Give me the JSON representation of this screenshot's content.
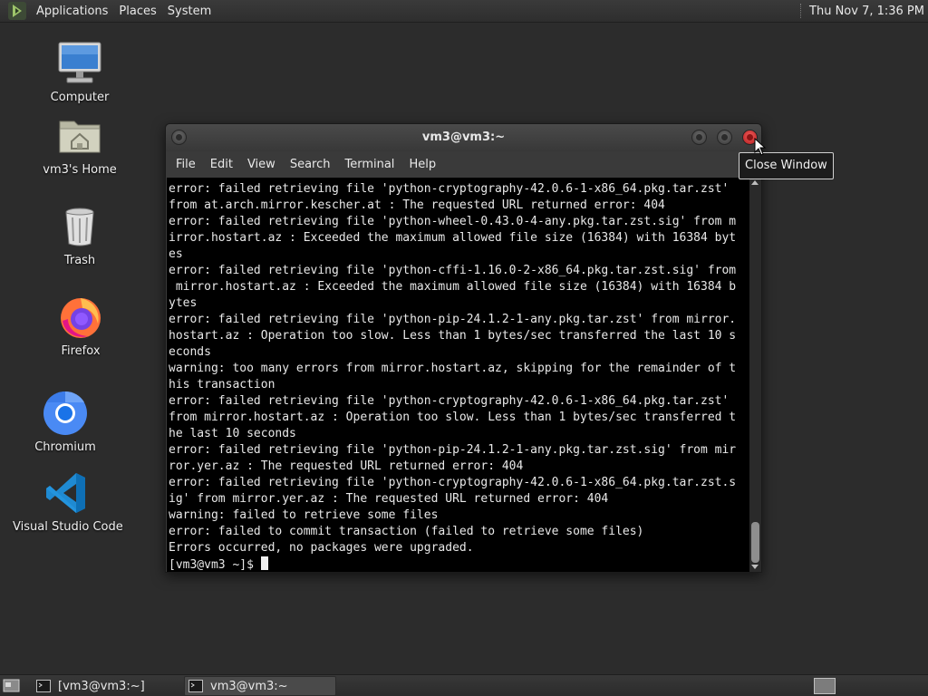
{
  "top_panel": {
    "menus": [
      "Applications",
      "Places",
      "System"
    ],
    "clock": "Thu Nov 7,  1:36 PM"
  },
  "desktop_icons": [
    {
      "label": "Computer",
      "icon": "computer-icon"
    },
    {
      "label": "vm3's Home",
      "icon": "home-folder-icon"
    },
    {
      "label": "Trash",
      "icon": "trash-icon"
    },
    {
      "label": "Firefox",
      "icon": "firefox-icon"
    },
    {
      "label": "Chromium",
      "icon": "chromium-icon"
    },
    {
      "label": "Visual Studio Code",
      "icon": "vscode-icon"
    }
  ],
  "terminal": {
    "title": "vm3@vm3:~",
    "menu": [
      "File",
      "Edit",
      "View",
      "Search",
      "Terminal",
      "Help"
    ],
    "lines": [
      "error: failed retrieving file 'python-cryptography-42.0.6-1-x86_64.pkg.tar.zst'",
      "from at.arch.mirror.kescher.at : The requested URL returned error: 404",
      "error: failed retrieving file 'python-wheel-0.43.0-4-any.pkg.tar.zst.sig' from m",
      "irror.hostart.az : Exceeded the maximum allowed file size (16384) with 16384 byt",
      "es",
      "error: failed retrieving file 'python-cffi-1.16.0-2-x86_64.pkg.tar.zst.sig' from",
      " mirror.hostart.az : Exceeded the maximum allowed file size (16384) with 16384 b",
      "ytes",
      "error: failed retrieving file 'python-pip-24.1.2-1-any.pkg.tar.zst' from mirror.",
      "hostart.az : Operation too slow. Less than 1 bytes/sec transferred the last 10 s",
      "econds",
      "warning: too many errors from mirror.hostart.az, skipping for the remainder of t",
      "his transaction",
      "error: failed retrieving file 'python-cryptography-42.0.6-1-x86_64.pkg.tar.zst'",
      "from mirror.hostart.az : Operation too slow. Less than 1 bytes/sec transferred t",
      "he last 10 seconds",
      "error: failed retrieving file 'python-pip-24.1.2-1-any.pkg.tar.zst.sig' from mir",
      "ror.yer.az : The requested URL returned error: 404",
      "error: failed retrieving file 'python-cryptography-42.0.6-1-x86_64.pkg.tar.zst.s",
      "ig' from mirror.yer.az : The requested URL returned error: 404",
      "warning: failed to retrieve some files",
      "error: failed to commit transaction (failed to retrieve some files)",
      "Errors occurred, no packages were upgraded."
    ],
    "prompt": "[vm3@vm3 ~]$ "
  },
  "tooltip": "Close Window",
  "taskbar": {
    "tasks": [
      {
        "label": "[vm3@vm3:~]",
        "active": false
      },
      {
        "label": "vm3@vm3:~",
        "active": true
      }
    ]
  },
  "colors": {
    "desktop_bg": "#2c2c2c",
    "terminal_bg": "#000000",
    "close_button": "#d63030"
  }
}
